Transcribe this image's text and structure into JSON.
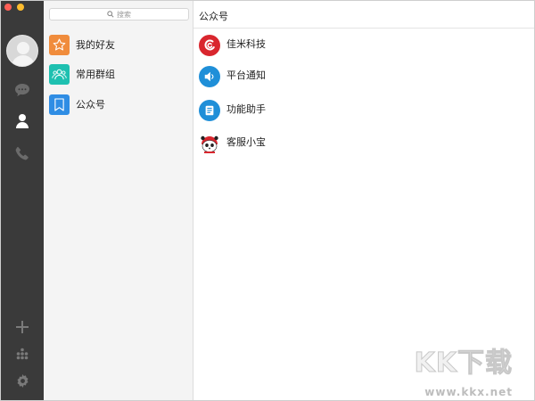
{
  "window": {
    "controls": [
      "close",
      "minimize"
    ]
  },
  "rail": {
    "items": [
      {
        "icon": "chat-bubble-icon"
      },
      {
        "icon": "contacts-icon",
        "active": true
      },
      {
        "icon": "phone-icon"
      },
      {
        "icon": "add-icon"
      },
      {
        "icon": "apps-grid-icon"
      },
      {
        "icon": "settings-gear-icon"
      }
    ]
  },
  "search": {
    "placeholder": "搜索"
  },
  "nav": {
    "items": [
      {
        "label": "我的好友",
        "icon": "star-icon",
        "color": "#f08c3c"
      },
      {
        "label": "常用群组",
        "icon": "group-icon",
        "color": "#1ec0b0"
      },
      {
        "label": "公众号",
        "icon": "bookmark-icon",
        "color": "#2f8de4"
      }
    ]
  },
  "detail": {
    "title": "公众号",
    "accounts": [
      {
        "name": "佳米科技",
        "icon": "jiami-logo-icon",
        "color": "#d9262e"
      },
      {
        "name": "平台通知",
        "icon": "speaker-icon",
        "color": "#1f8fd8"
      },
      {
        "name": "功能助手",
        "icon": "assistant-icon",
        "color": "#1f8fd8"
      },
      {
        "name": "客服小宝",
        "icon": "panda-mascot-icon",
        "color": "#d9262e"
      }
    ]
  },
  "watermark": {
    "logo": "KK下载",
    "url": "www.kkx.net"
  }
}
